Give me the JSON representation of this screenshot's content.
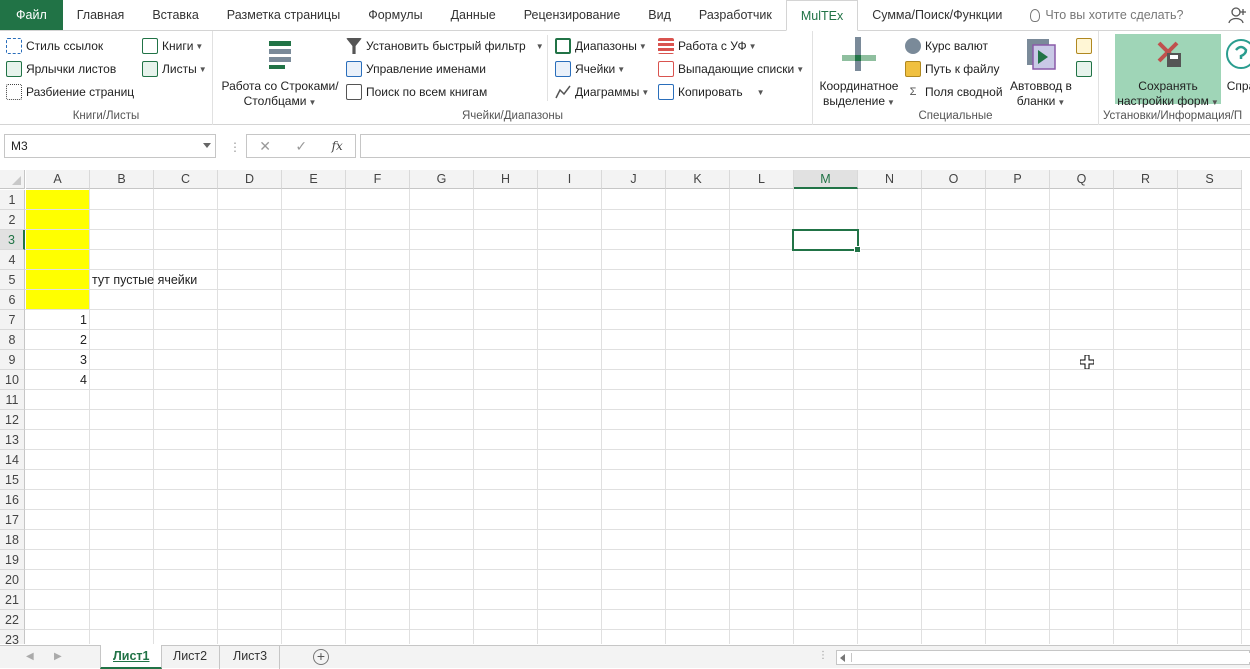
{
  "tabs": [
    "Файл",
    "Главная",
    "Вставка",
    "Разметка страницы",
    "Формулы",
    "Данные",
    "Рецензирование",
    "Вид",
    "Разработчик",
    "MulTEx",
    "Сумма/Поиск/Функции"
  ],
  "active_tab": "MulTEx",
  "tell_me": "Что вы хотите сделать?",
  "ribbon": {
    "g1": {
      "label": "Книги/Листы",
      "b1": "Стиль ссылок",
      "b2": "Ярлычки листов",
      "b3": "Разбиение страниц",
      "b4": "Книги",
      "b5": "Листы"
    },
    "g2": {
      "label": "Ячейки/Диапазоны",
      "big1": "Работа со Строками/",
      "big1b": "Столбцами",
      "b1": "Установить быстрый фильтр",
      "b2": "Управление именами",
      "b3": "Поиск по всем книгам",
      "b4": "Диапазоны",
      "b5": "Ячейки",
      "b6": "Диаграммы",
      "b7": "Работа с УФ",
      "b8": "Выпадающие списки",
      "b9": "Копировать"
    },
    "g3": {
      "label": "Специальные",
      "big1": "Координатное",
      "big1b": "выделение",
      "b1": "Курс валют",
      "b2": "Путь к файлу",
      "b3": "Поля сводной",
      "big2": "Автоввод в",
      "big2b": "бланки"
    },
    "g4": {
      "label": "Установки/Информация/П",
      "big1": "Сохранять",
      "big1b": "настройки форм",
      "big2": "Спра"
    }
  },
  "formula_bar": {
    "name_box": "M3",
    "fx": "fx",
    "value": ""
  },
  "columns": [
    "A",
    "B",
    "C",
    "D",
    "E",
    "F",
    "G",
    "H",
    "I",
    "J",
    "K",
    "L",
    "M",
    "N",
    "O",
    "P",
    "Q",
    "R",
    "S"
  ],
  "selected_column": "M",
  "rows": [
    "1",
    "2",
    "3",
    "4",
    "5",
    "6",
    "7",
    "8",
    "9",
    "10",
    "11",
    "12",
    "13",
    "14",
    "15",
    "16",
    "17",
    "18",
    "19",
    "20",
    "21",
    "22",
    "23"
  ],
  "selected_row": "3",
  "cells": {
    "a7": "1",
    "a8": "2",
    "a9": "3",
    "a10": "4",
    "b5": "тут пустые ячейки"
  },
  "highlight_color": "#ffff00",
  "accent_color": "#217346",
  "sheets": [
    "Лист1",
    "Лист2",
    "Лист3"
  ],
  "active_sheet": "Лист1"
}
